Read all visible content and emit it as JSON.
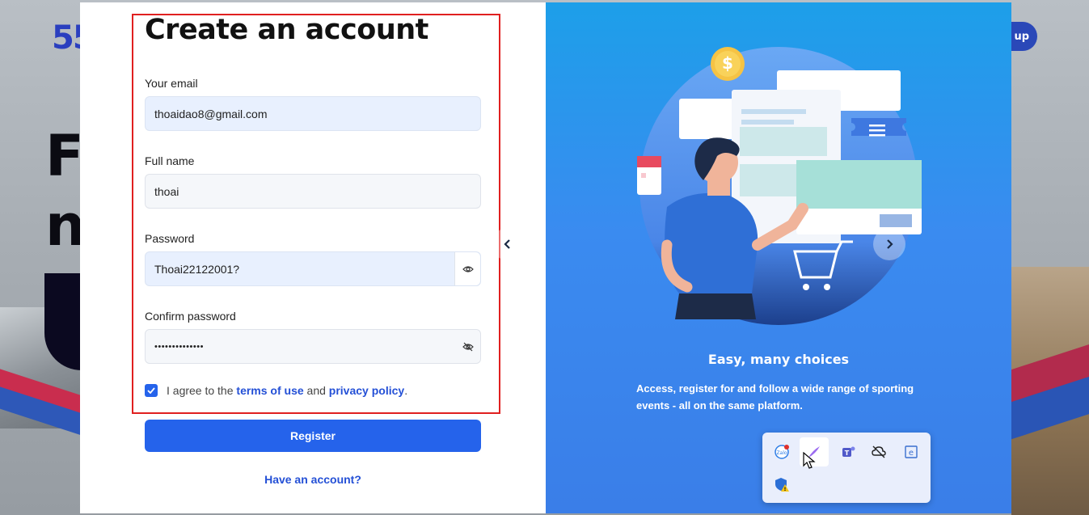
{
  "background": {
    "logo_text": "55",
    "hero_line1": "F",
    "hero_line2": "n",
    "signup_label": "up"
  },
  "form": {
    "title": "Create an account",
    "email_label": "Your email",
    "email_value": "thoaidao8@gmail.com",
    "fullname_label": "Full name",
    "fullname_value": "thoai",
    "password_label": "Password",
    "password_value": "Thoai22122001?",
    "confirm_label": "Confirm password",
    "confirm_value": "••••••••••••••",
    "agree_prefix": "I agree to the",
    "terms_link": "terms of use",
    "agree_and": "and",
    "privacy_link": "privacy policy",
    "agree_suffix": ".",
    "terms_checked": true,
    "register_label": "Register",
    "have_account_label": "Have an account?"
  },
  "slide": {
    "title": "Easy, many choices",
    "description": "Access, register for and follow a wide range of sporting events - all on the same platform.",
    "coin_symbol": "$"
  },
  "tray": {
    "icons": [
      "zalo-icon",
      "quill-icon",
      "teams-icon",
      "cloud-off-icon",
      "editor-icon",
      "security-warning-icon"
    ]
  },
  "colors": {
    "accent": "#2563eb",
    "link": "#2450d6",
    "highlight": "#e02020",
    "slide_bg": "#3a8bf0"
  }
}
